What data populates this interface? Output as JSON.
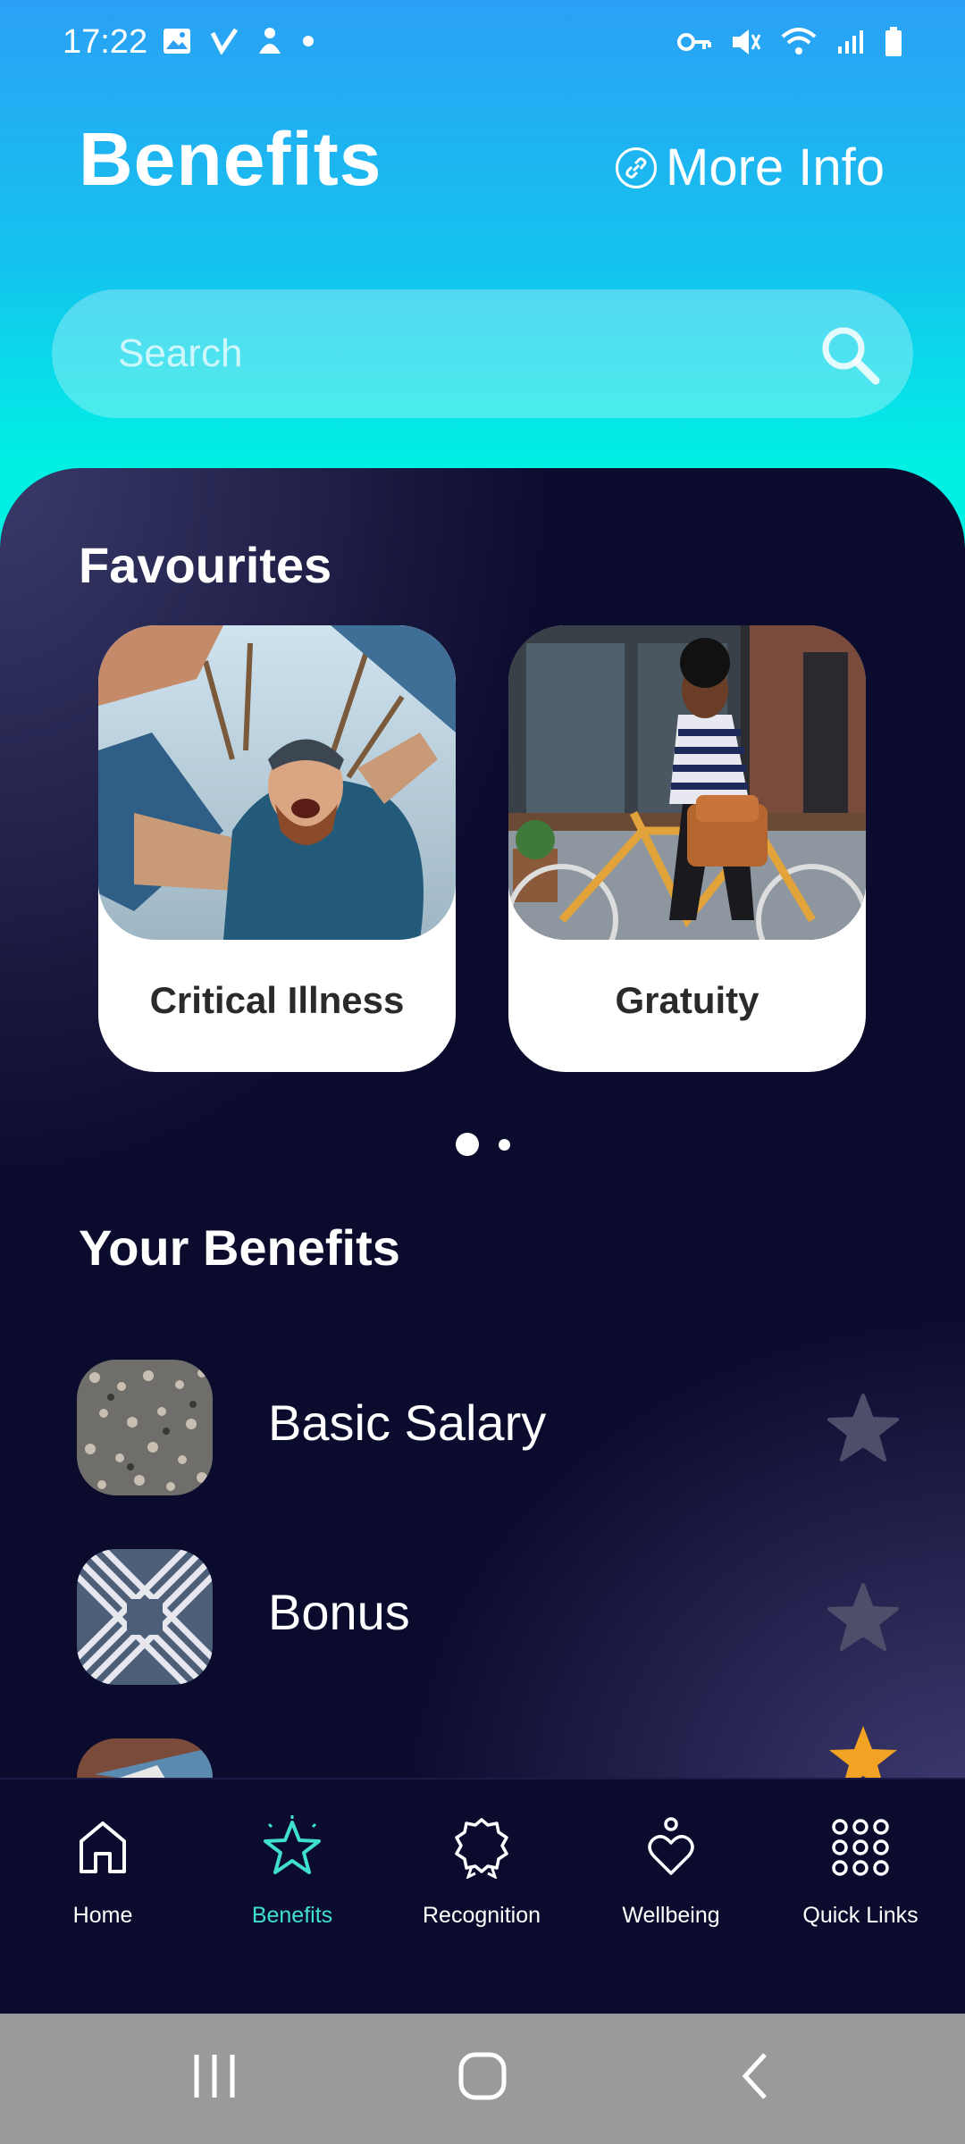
{
  "status_bar": {
    "time": "17:22",
    "left_icons": [
      "image-icon",
      "check-v-icon",
      "person-icon",
      "dot-icon"
    ],
    "right_icons": [
      "key-icon",
      "mute-icon",
      "wifi-icon",
      "signal-icon",
      "battery-icon"
    ]
  },
  "header": {
    "title": "Benefits",
    "more_info_label": "More Info"
  },
  "search": {
    "placeholder": "Search"
  },
  "favourites": {
    "title": "Favourites",
    "items": [
      {
        "label": "Critical Illness",
        "image": "man-laughing-photo"
      },
      {
        "label": "Gratuity",
        "image": "woman-bicycle-photo"
      }
    ],
    "pager": {
      "page_count": 2,
      "active_index": 0
    }
  },
  "your_benefits": {
    "title": "Your Benefits",
    "items": [
      {
        "label": "Basic Salary",
        "thumb": "crowd-aerial-photo",
        "favourite": false
      },
      {
        "label": "Bonus",
        "thumb": "crosswalk-aerial-photo",
        "favourite": false
      }
    ]
  },
  "bottom_nav": {
    "items": [
      {
        "label": "Home",
        "icon": "home-icon",
        "active": false
      },
      {
        "label": "Benefits",
        "icon": "star-icon",
        "active": true
      },
      {
        "label": "Recognition",
        "icon": "award-icon",
        "active": false
      },
      {
        "label": "Wellbeing",
        "icon": "heart-icon",
        "active": false
      },
      {
        "label": "Quick Links",
        "icon": "grid-icon",
        "active": false
      }
    ]
  },
  "system_nav": {
    "icons": [
      "recent-apps-icon",
      "home-circle-icon",
      "back-icon"
    ]
  },
  "colors": {
    "accent": "#3fe0d2",
    "card_bg": "#0b0b2e",
    "header_gradient_top": "#2ba0f5",
    "header_gradient_bottom": "#00f0e4",
    "star_inactive": "#4e4e6a"
  }
}
